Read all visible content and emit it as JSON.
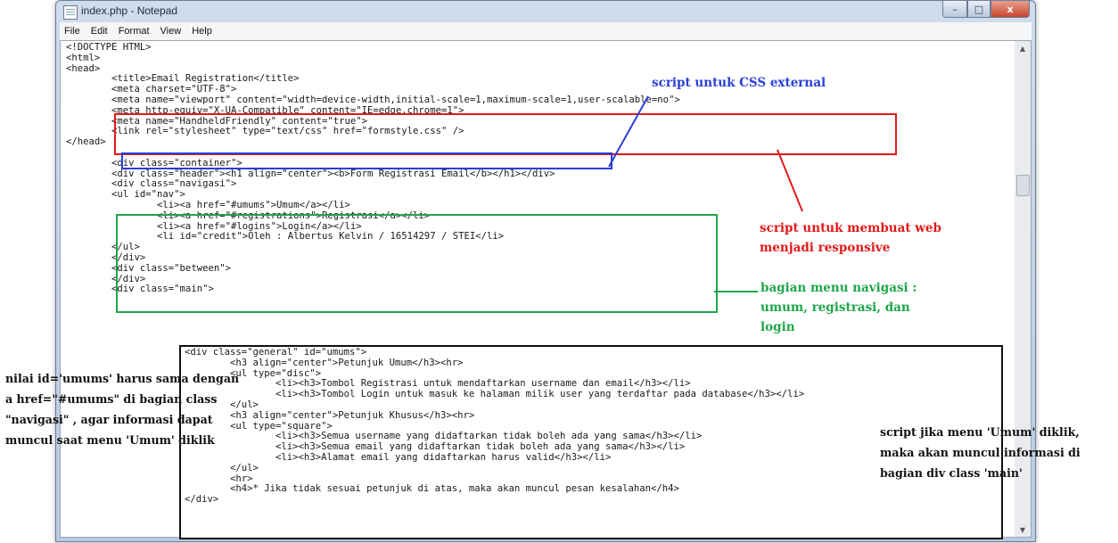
{
  "window": {
    "title": "index.php - Notepad",
    "buttons": {
      "minimize": "–",
      "maximize": "□",
      "close": "x"
    }
  },
  "menu": [
    "File",
    "Edit",
    "Format",
    "View",
    "Help"
  ],
  "code_text": "<!DOCTYPE HTML>\n<html>\n<head>\n        <title>Email Registration</title>\n        <meta charset=\"UTF-8\">\n        <meta name=\"viewport\" content=\"width=device-width,initial-scale=1,maximum-scale=1,user-scalable=no\">\n        <meta http-equiv=\"X-UA-Compatible\" content=\"IE=edge,chrome=1\">\n        <meta name=\"HandheldFriendly\" content=\"true\">\n        <link rel=\"stylesheet\" type=\"text/css\" href=\"formstyle.css\" />\n</head>\n\n        <div class=\"container\">\n        <div class=\"header\"><h1 align=\"center\"><b>Form Registrasi Email</b></h1></div>\n        <div class=\"navigasi\">\n        <ul id=\"nav\">\n                <li><a href=\"#umums\">Umum</a></li>\n                <li><a href=\"#registrations\">Registrasi</a></li>\n                <li><a href=\"#logins\">Login</a></li>\n                <li id=\"credit\">Oleh : Albertus Kelvin / 16514297 / STEI</li>\n        </ul>\n        </div>\n        <div class=\"between\">\n        </div>\n        <div class=\"main\">",
  "main_block_text": "<div class=\"general\" id=\"umums\">\n        <h3 align=\"center\">Petunjuk Umum</h3><hr>\n        <ul type=\"disc\">\n                <li><h3>Tombol Registrasi untuk mendaftarkan username dan email</h3></li>\n                <li><h3>Tombol Login untuk masuk ke halaman milik user yang terdaftar pada database</h3></li>\n        </ul>\n        <h3 align=\"center\">Petunjuk Khusus</h3><hr>\n        <ul type=\"square\">\n                <li><h3>Semua username yang didaftarkan tidak boleh ada yang sama</h3></li>\n                <li><h3>Semua email yang didaftarkan tidak boleh ada yang sama</h3></li>\n                <li><h3>Alamat email yang didaftarkan harus valid</h3></li>\n        </ul>\n        <hr>\n        <h4>* Jika tidak sesuai petunjuk di atas, maka akan muncul pesan kesalahan</h4>\n</div>",
  "annotations": {
    "css_external": "script untuk CSS external",
    "responsive": "script untuk membuat web menjadi responsive",
    "navigation": "bagian menu navigasi : umum, registrasi, dan login",
    "left_note": "nilai id='umums' harus sama dengan a href=\"#umums\" di bagian class \"navigasi\" , agar informasi dapat muncul saat menu 'Umum' diklik",
    "right_note": "script jika menu 'Umum' diklik, maka akan muncul informasi di bagian div class 'main'"
  },
  "colors": {
    "red": "#e11919",
    "blue": "#2b3fd8",
    "green": "#1fa64a",
    "black": "#111111"
  }
}
